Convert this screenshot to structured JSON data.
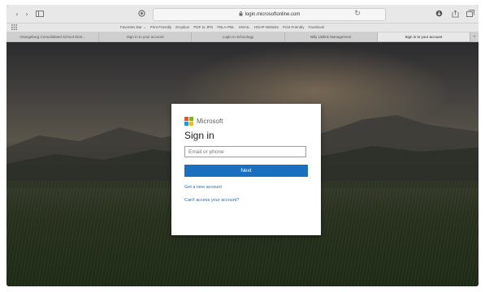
{
  "browser": {
    "url": "login.microsoftonline.com",
    "favorites": [
      "Favorites Bar ⌄",
      "Print Friendly",
      "Dropbox",
      "PDF to JPG",
      "FBLA-PBL",
      "GMAIL",
      "HGHP Website",
      "Print Friendly",
      "Facebook"
    ],
    "tabs": [
      {
        "label": "Orangeburg Consolidated School Distr...",
        "active": false
      },
      {
        "label": "Sign in to your account",
        "active": false
      },
      {
        "label": "Login to Schoology",
        "active": false
      },
      {
        "label": "Billy LiBlink Management",
        "active": false
      },
      {
        "label": "Sign in to your account",
        "active": true
      }
    ]
  },
  "signin": {
    "brand": "Microsoft",
    "title": "Sign in",
    "email_placeholder": "Email or phone",
    "next_label": "Next",
    "link_new_account": "Get a new account",
    "link_cant_access": "Can't access your account?"
  },
  "colors": {
    "accent": "#1b6fbf",
    "logo_red": "#f25022",
    "logo_green": "#7fba00",
    "logo_blue": "#00a4ef",
    "logo_yellow": "#ffb900"
  }
}
